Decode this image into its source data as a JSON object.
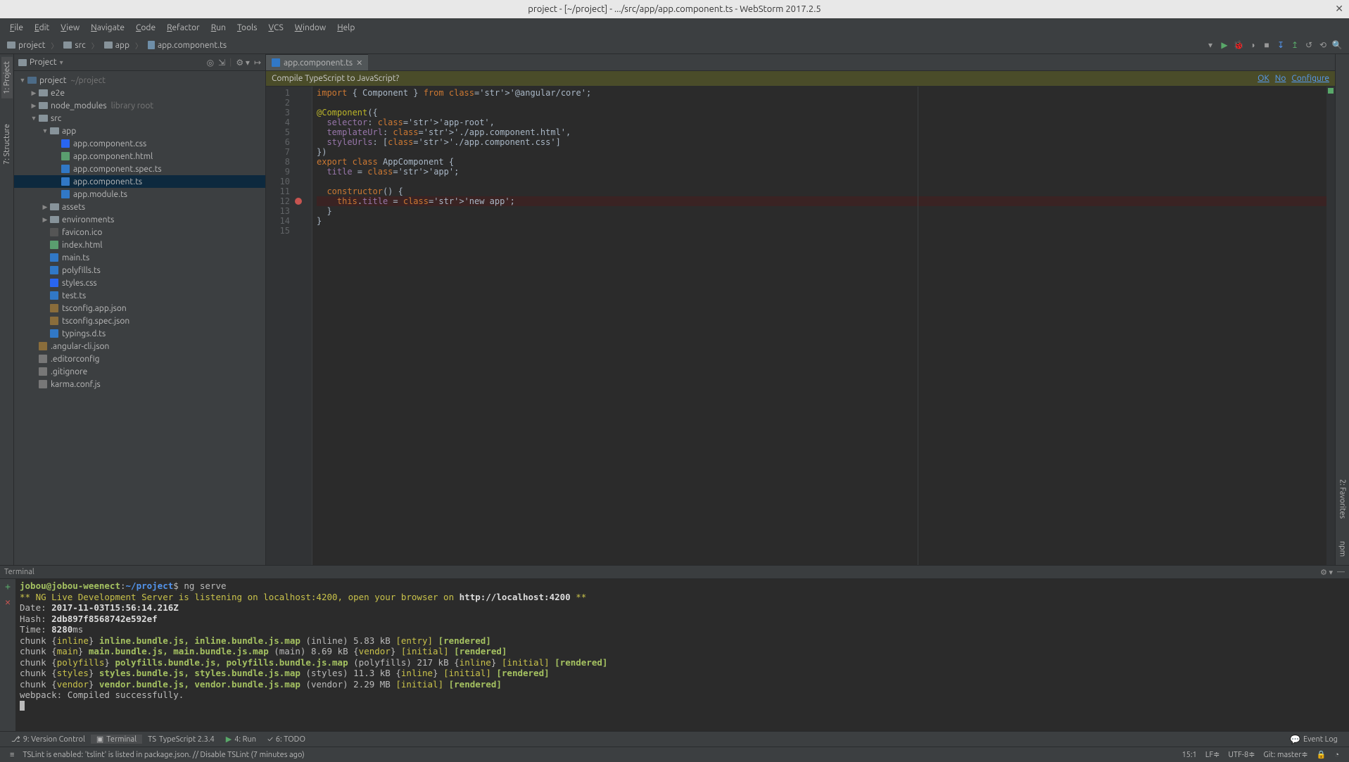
{
  "title": "project - [~/project] - .../src/app/app.component.ts - WebStorm 2017.2.5",
  "menu": [
    "File",
    "Edit",
    "View",
    "Navigate",
    "Code",
    "Refactor",
    "Run",
    "Tools",
    "VCS",
    "Window",
    "Help"
  ],
  "breadcrumbs": [
    {
      "label": "project",
      "type": "folder"
    },
    {
      "label": "src",
      "type": "folder"
    },
    {
      "label": "app",
      "type": "folder"
    },
    {
      "label": "app.component.ts",
      "type": "file"
    }
  ],
  "project_panel": {
    "title": "Project",
    "tree": [
      {
        "d": 0,
        "a": "▼",
        "i": "folder-dk",
        "l": "project",
        "hint": "~/project"
      },
      {
        "d": 1,
        "a": "▶",
        "i": "folder",
        "l": "e2e"
      },
      {
        "d": 1,
        "a": "▶",
        "i": "folder",
        "l": "node_modules",
        "hint": "library root"
      },
      {
        "d": 1,
        "a": "▼",
        "i": "folder",
        "l": "src"
      },
      {
        "d": 2,
        "a": "▼",
        "i": "folder",
        "l": "app"
      },
      {
        "d": 3,
        "a": "",
        "i": "css",
        "l": "app.component.css"
      },
      {
        "d": 3,
        "a": "",
        "i": "html",
        "l": "app.component.html"
      },
      {
        "d": 3,
        "a": "",
        "i": "ts",
        "l": "app.component.spec.ts"
      },
      {
        "d": 3,
        "a": "",
        "i": "ts",
        "l": "app.component.ts",
        "sel": true
      },
      {
        "d": 3,
        "a": "",
        "i": "ts",
        "l": "app.module.ts"
      },
      {
        "d": 2,
        "a": "▶",
        "i": "folder",
        "l": "assets"
      },
      {
        "d": 2,
        "a": "▶",
        "i": "folder",
        "l": "environments"
      },
      {
        "d": 2,
        "a": "",
        "i": "ico",
        "l": "favicon.ico"
      },
      {
        "d": 2,
        "a": "",
        "i": "html",
        "l": "index.html"
      },
      {
        "d": 2,
        "a": "",
        "i": "ts",
        "l": "main.ts"
      },
      {
        "d": 2,
        "a": "",
        "i": "ts",
        "l": "polyfills.ts"
      },
      {
        "d": 2,
        "a": "",
        "i": "css",
        "l": "styles.css"
      },
      {
        "d": 2,
        "a": "",
        "i": "ts",
        "l": "test.ts"
      },
      {
        "d": 2,
        "a": "",
        "i": "json",
        "l": "tsconfig.app.json"
      },
      {
        "d": 2,
        "a": "",
        "i": "json",
        "l": "tsconfig.spec.json"
      },
      {
        "d": 2,
        "a": "",
        "i": "ts",
        "l": "typings.d.ts"
      },
      {
        "d": 1,
        "a": "",
        "i": "json",
        "l": ".angular-cli.json"
      },
      {
        "d": 1,
        "a": "",
        "i": "generic",
        "l": ".editorconfig"
      },
      {
        "d": 1,
        "a": "",
        "i": "generic",
        "l": ".gitignore"
      },
      {
        "d": 1,
        "a": "",
        "i": "generic",
        "l": "karma.conf.js"
      }
    ]
  },
  "editor": {
    "tab_label": "app.component.ts",
    "compile_prompt": "Compile TypeScript to JavaScript?",
    "compile_actions": [
      "OK",
      "No",
      "Configure"
    ],
    "breakpoint_line": 12,
    "lines": [
      "import { Component } from '@angular/core';",
      "",
      "@Component({",
      "  selector: 'app-root',",
      "  templateUrl: './app.component.html',",
      "  styleUrls: ['./app.component.css']",
      "})",
      "export class AppComponent {",
      "  title = 'app';",
      "",
      "  constructor() {",
      "    this.title = 'new app';",
      "  }",
      "}",
      ""
    ]
  },
  "terminal": {
    "title": "Terminal",
    "prompt_user": "jobou@jobou-weenect",
    "prompt_path": "~/project",
    "prompt_cmd": "ng serve",
    "lines": [
      {
        "seg": [
          {
            "c": "tyellow",
            "t": "** NG Live Development Server is listening on localhost:4200, open your browser on "
          },
          {
            "c": "tbold",
            "t": "http://localhost:4200"
          },
          {
            "c": "tyellow",
            "t": " **"
          }
        ]
      },
      {
        "seg": [
          {
            "c": "",
            "t": "Date: "
          },
          {
            "c": "tbold",
            "t": "2017-11-03T15:56:14.216Z"
          }
        ]
      },
      {
        "seg": [
          {
            "c": "",
            "t": "Hash: "
          },
          {
            "c": "tbold",
            "t": "2db897f8568742e592ef"
          }
        ]
      },
      {
        "seg": [
          {
            "c": "",
            "t": "Time: "
          },
          {
            "c": "tbold",
            "t": "8280"
          },
          {
            "c": "",
            "t": "ms"
          }
        ]
      },
      {
        "seg": [
          {
            "c": "",
            "t": "chunk {"
          },
          {
            "c": "tyellow",
            "t": "inline"
          },
          {
            "c": "",
            "t": "} "
          },
          {
            "c": "tgreen",
            "t": "inline.bundle.js, inline.bundle.js.map"
          },
          {
            "c": "",
            "t": " (inline) 5.83 kB "
          },
          {
            "c": "tyellow",
            "t": "[entry]"
          },
          {
            "c": "",
            "t": " "
          },
          {
            "c": "tgreen",
            "t": "[rendered]"
          }
        ]
      },
      {
        "seg": [
          {
            "c": "",
            "t": "chunk {"
          },
          {
            "c": "tyellow",
            "t": "main"
          },
          {
            "c": "",
            "t": "} "
          },
          {
            "c": "tgreen",
            "t": "main.bundle.js, main.bundle.js.map"
          },
          {
            "c": "",
            "t": " (main) 8.69 kB {"
          },
          {
            "c": "tyellow",
            "t": "vendor"
          },
          {
            "c": "",
            "t": "} "
          },
          {
            "c": "tyellow",
            "t": "[initial]"
          },
          {
            "c": "",
            "t": " "
          },
          {
            "c": "tgreen",
            "t": "[rendered]"
          }
        ]
      },
      {
        "seg": [
          {
            "c": "",
            "t": "chunk {"
          },
          {
            "c": "tyellow",
            "t": "polyfills"
          },
          {
            "c": "",
            "t": "} "
          },
          {
            "c": "tgreen",
            "t": "polyfills.bundle.js, polyfills.bundle.js.map"
          },
          {
            "c": "",
            "t": " (polyfills) 217 kB {"
          },
          {
            "c": "tyellow",
            "t": "inline"
          },
          {
            "c": "",
            "t": "} "
          },
          {
            "c": "tyellow",
            "t": "[initial]"
          },
          {
            "c": "",
            "t": " "
          },
          {
            "c": "tgreen",
            "t": "[rendered]"
          }
        ]
      },
      {
        "seg": [
          {
            "c": "",
            "t": "chunk {"
          },
          {
            "c": "tyellow",
            "t": "styles"
          },
          {
            "c": "",
            "t": "} "
          },
          {
            "c": "tgreen",
            "t": "styles.bundle.js, styles.bundle.js.map"
          },
          {
            "c": "",
            "t": " (styles) 11.3 kB {"
          },
          {
            "c": "tyellow",
            "t": "inline"
          },
          {
            "c": "",
            "t": "} "
          },
          {
            "c": "tyellow",
            "t": "[initial]"
          },
          {
            "c": "",
            "t": " "
          },
          {
            "c": "tgreen",
            "t": "[rendered]"
          }
        ]
      },
      {
        "seg": [
          {
            "c": "",
            "t": "chunk {"
          },
          {
            "c": "tyellow",
            "t": "vendor"
          },
          {
            "c": "",
            "t": "} "
          },
          {
            "c": "tgreen",
            "t": "vendor.bundle.js, vendor.bundle.js.map"
          },
          {
            "c": "",
            "t": " (vendor) 2.29 MB "
          },
          {
            "c": "tyellow",
            "t": "[initial]"
          },
          {
            "c": "",
            "t": " "
          },
          {
            "c": "tgreen",
            "t": "[rendered]"
          }
        ]
      },
      {
        "seg": [
          {
            "c": "",
            "t": ""
          }
        ]
      },
      {
        "seg": [
          {
            "c": "",
            "t": "webpack: Compiled successfully."
          }
        ]
      }
    ]
  },
  "left_tool_tabs": [
    "1: Project",
    "7: Structure"
  ],
  "right_tool_tabs": [
    "npm",
    "2: Favorites"
  ],
  "bottom_tabs": [
    {
      "icon": "⎇",
      "label": "9: Version Control"
    },
    {
      "icon": "▣",
      "label": "Terminal",
      "sel": true
    },
    {
      "icon": "TS",
      "label": "TypeScript 2.3.4"
    },
    {
      "icon": "▶",
      "label": "4: Run",
      "green": true
    },
    {
      "icon": "✓",
      "label": "6: TODO"
    }
  ],
  "event_log": "Event Log",
  "status": {
    "msg": "TSLint is enabled: 'tslint' is listed in package.json. // Disable TSLint (7 minutes ago)",
    "pos": "15:1",
    "lf": "LF≑",
    "enc": "UTF-8≑",
    "git": "Git: master≑",
    "lock": "🔒"
  }
}
